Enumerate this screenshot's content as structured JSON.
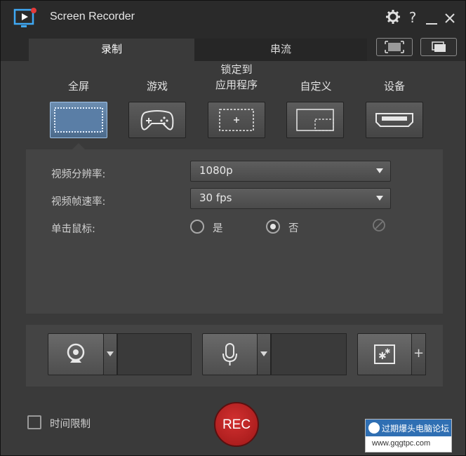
{
  "window": {
    "title": "Screen Recorder",
    "controls": [
      "gear-icon",
      "help-icon",
      "minimize-icon",
      "close-icon"
    ],
    "help_label": "?"
  },
  "tabs": [
    {
      "label": "录制",
      "active": true
    },
    {
      "label": "串流",
      "active": false
    }
  ],
  "modes": [
    {
      "label": "全屏",
      "icon": "fullscreen-icon",
      "selected": true
    },
    {
      "label": "游戏",
      "icon": "gamepad-icon",
      "selected": false
    },
    {
      "label": "锁定到\n应用程序",
      "icon": "app-lock-icon",
      "selected": false
    },
    {
      "label": "自定义",
      "icon": "custom-region-icon",
      "selected": false
    },
    {
      "label": "设备",
      "icon": "hdmi-device-icon",
      "selected": false
    }
  ],
  "settings": {
    "resolution_label": "视频分辨率:",
    "resolution_value": "1080p",
    "framerate_label": "视频帧速率:",
    "framerate_value": "30 fps",
    "mouse_click_label": "单击鼠标:",
    "option_yes": "是",
    "option_no": "否",
    "mouse_click_selected": "否"
  },
  "devices": {
    "webcam_icon": "webcam-icon",
    "mic_icon": "microphone-icon",
    "effects_icon": "effects-icon",
    "add_label": "+"
  },
  "footer": {
    "time_limit_label": "时间限制",
    "time_limit_checked": false,
    "rec_label": "REC"
  },
  "watermark": {
    "line1": "过期爆头电脑论坛",
    "line2": "www.gqgtpc.com"
  },
  "colors": {
    "accent": "#7aa6d6",
    "rec": "#b01f1f"
  }
}
